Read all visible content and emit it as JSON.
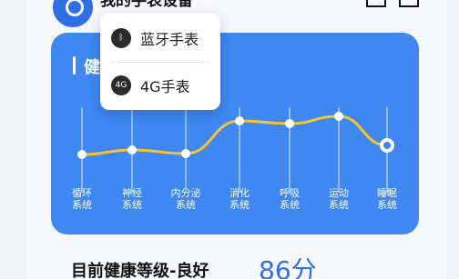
{
  "header": {
    "title": "我的手表设备"
  },
  "dropdown": {
    "items": [
      {
        "label": "蓝牙手表",
        "icon": "bluetooth-icon",
        "badge": "ᛒ"
      },
      {
        "label": "4G手表",
        "icon": "4g-icon",
        "badge": "4G"
      }
    ]
  },
  "card": {
    "title": "健康评估",
    "background": "#3f87f1",
    "line_color": "#f5c331"
  },
  "chart_data": {
    "type": "line",
    "categories": [
      "循环\n系统",
      "神经\n系统",
      "内分泌\n系统",
      "消化\n系统",
      "呼吸\n系统",
      "运动\n系统",
      "睡眠\n系统"
    ],
    "values": [
      0.26,
      0.31,
      0.27,
      0.63,
      0.6,
      0.68,
      0.36
    ],
    "highlight_index": 6,
    "ylim": [
      0,
      1
    ],
    "grid": false
  },
  "summary": {
    "label": "目前健康等级-良好",
    "score": "86分"
  }
}
